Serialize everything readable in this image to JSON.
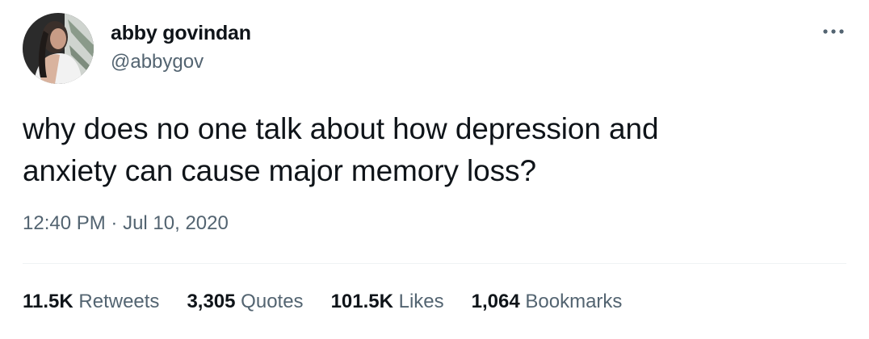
{
  "author": {
    "display_name": "abby govindan",
    "handle": "@abbygov",
    "avatar_icon": "profile-photo"
  },
  "more_icon": "more-horizontal-icon",
  "tweet": {
    "text": "why does no one talk about how depression and\nanxiety can cause major memory loss?",
    "time": "12:40 PM",
    "separator": "·",
    "date": "Jul 10, 2020"
  },
  "stats": {
    "retweets": {
      "count": "11.5K",
      "label": "Retweets"
    },
    "quotes": {
      "count": "3,305",
      "label": "Quotes"
    },
    "likes": {
      "count": "101.5K",
      "label": "Likes"
    },
    "bookmarks": {
      "count": "1,064",
      "label": "Bookmarks"
    }
  },
  "colors": {
    "text_primary": "#0f1419",
    "text_secondary": "#536471",
    "divider": "#eff3f4"
  }
}
